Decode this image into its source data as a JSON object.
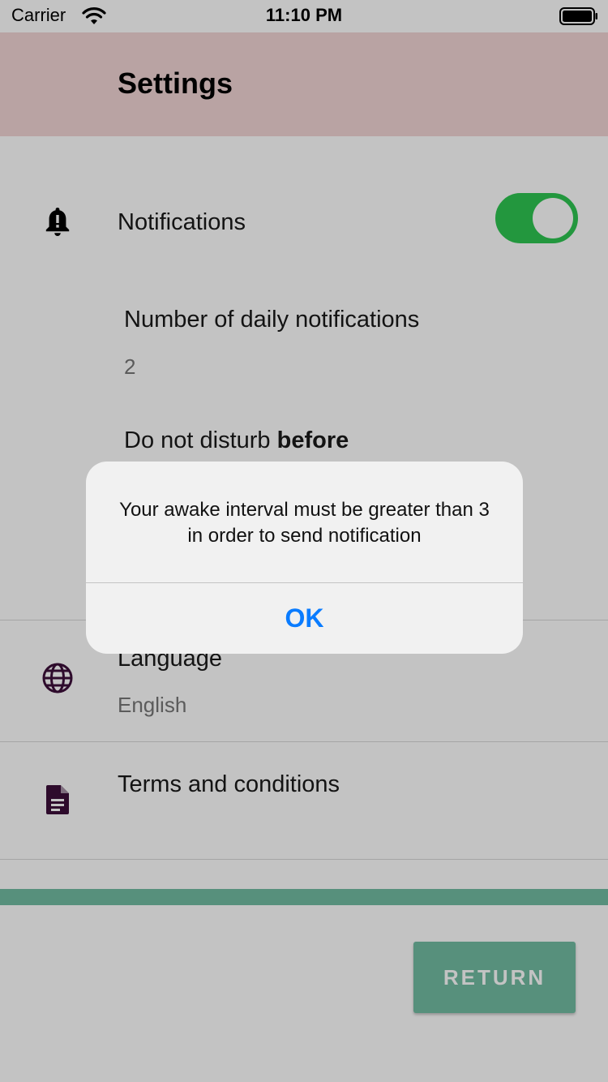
{
  "status_bar": {
    "carrier": "Carrier",
    "time": "11:10 PM"
  },
  "header": {
    "title": "Settings",
    "background": "#f2d5d5"
  },
  "notifications": {
    "label": "Notifications",
    "icon": "bell-icon",
    "enabled": true,
    "toggle_color": "#2fc652",
    "daily_count_label": "Number of daily notifications",
    "daily_count_value": "2",
    "dnd_before_prefix": "Do not disturb ",
    "dnd_before_emphasis": "before"
  },
  "language": {
    "label": "Language",
    "value": "English",
    "icon": "globe-icon"
  },
  "terms": {
    "label": "Terms and conditions",
    "icon": "document-icon"
  },
  "footer": {
    "return_label": "RETURN",
    "accent_color": "#72bda3"
  },
  "alert": {
    "message": "Your awake interval must be greater than 3 in order to send notification",
    "ok_label": "OK",
    "ok_color": "#0a7cff"
  }
}
